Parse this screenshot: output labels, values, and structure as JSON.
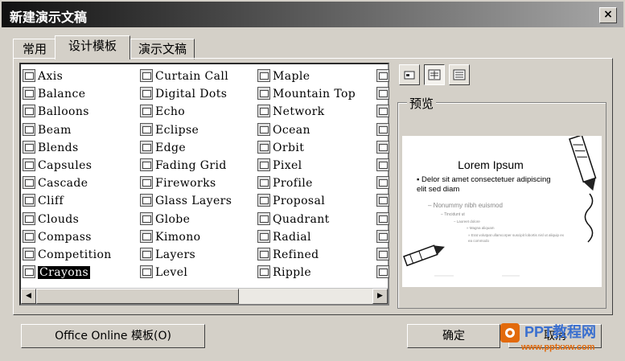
{
  "dialog": {
    "title": "新建演示文稿",
    "close_label": "×"
  },
  "tabs": [
    {
      "label": "常用"
    },
    {
      "label": "设计模板"
    },
    {
      "label": "演示文稿"
    }
  ],
  "templates": {
    "col1": [
      "Axis",
      "Balance",
      "Balloons",
      "Beam",
      "Blends",
      "Capsules",
      "Cascade",
      "Cliff",
      "Clouds",
      "Compass",
      "Competition",
      "Crayons"
    ],
    "col2": [
      "Curtain Call",
      "Digital Dots",
      "Echo",
      "Eclipse",
      "Edge",
      "Fading Grid",
      "Fireworks",
      "Glass Layers",
      "Globe",
      "Kimono",
      "Layers",
      "Level"
    ],
    "col3": [
      "Maple",
      "Mountain Top",
      "Network",
      "Ocean",
      "Orbit",
      "Pixel",
      "Profile",
      "Proposal",
      "Quadrant",
      "Radial",
      "Refined",
      "Ripple"
    ],
    "selected": "Crayons"
  },
  "preview": {
    "label": "预览",
    "slide_title": "Lorem Ipsum",
    "bullet1": "Delor sit amet consectetuer adipiscing elit sed diam",
    "bullet2": "– Nonummy nibh euismod",
    "bullet3": "– Tincidunt ut",
    "bullet4": "– Laoreet dolore",
    "bullet5": "» Magna aliquam",
    "bullet6": "» Erat volutpat ullamcorper suscipit lobortis nisl ut aliquip ex ea commodo"
  },
  "footer": {
    "office_online_label": "Office Online 模板(O)",
    "ok_label": "确定",
    "cancel_label": "取消"
  },
  "watermark": {
    "line1": "PPT教程网",
    "line2": "www.pptxxw.com"
  },
  "colors": {
    "title_bar_start": "#111111",
    "selected_bg": "#000000",
    "watermark_blue": "#3a6fcf",
    "watermark_orange": "#e26a0c"
  }
}
